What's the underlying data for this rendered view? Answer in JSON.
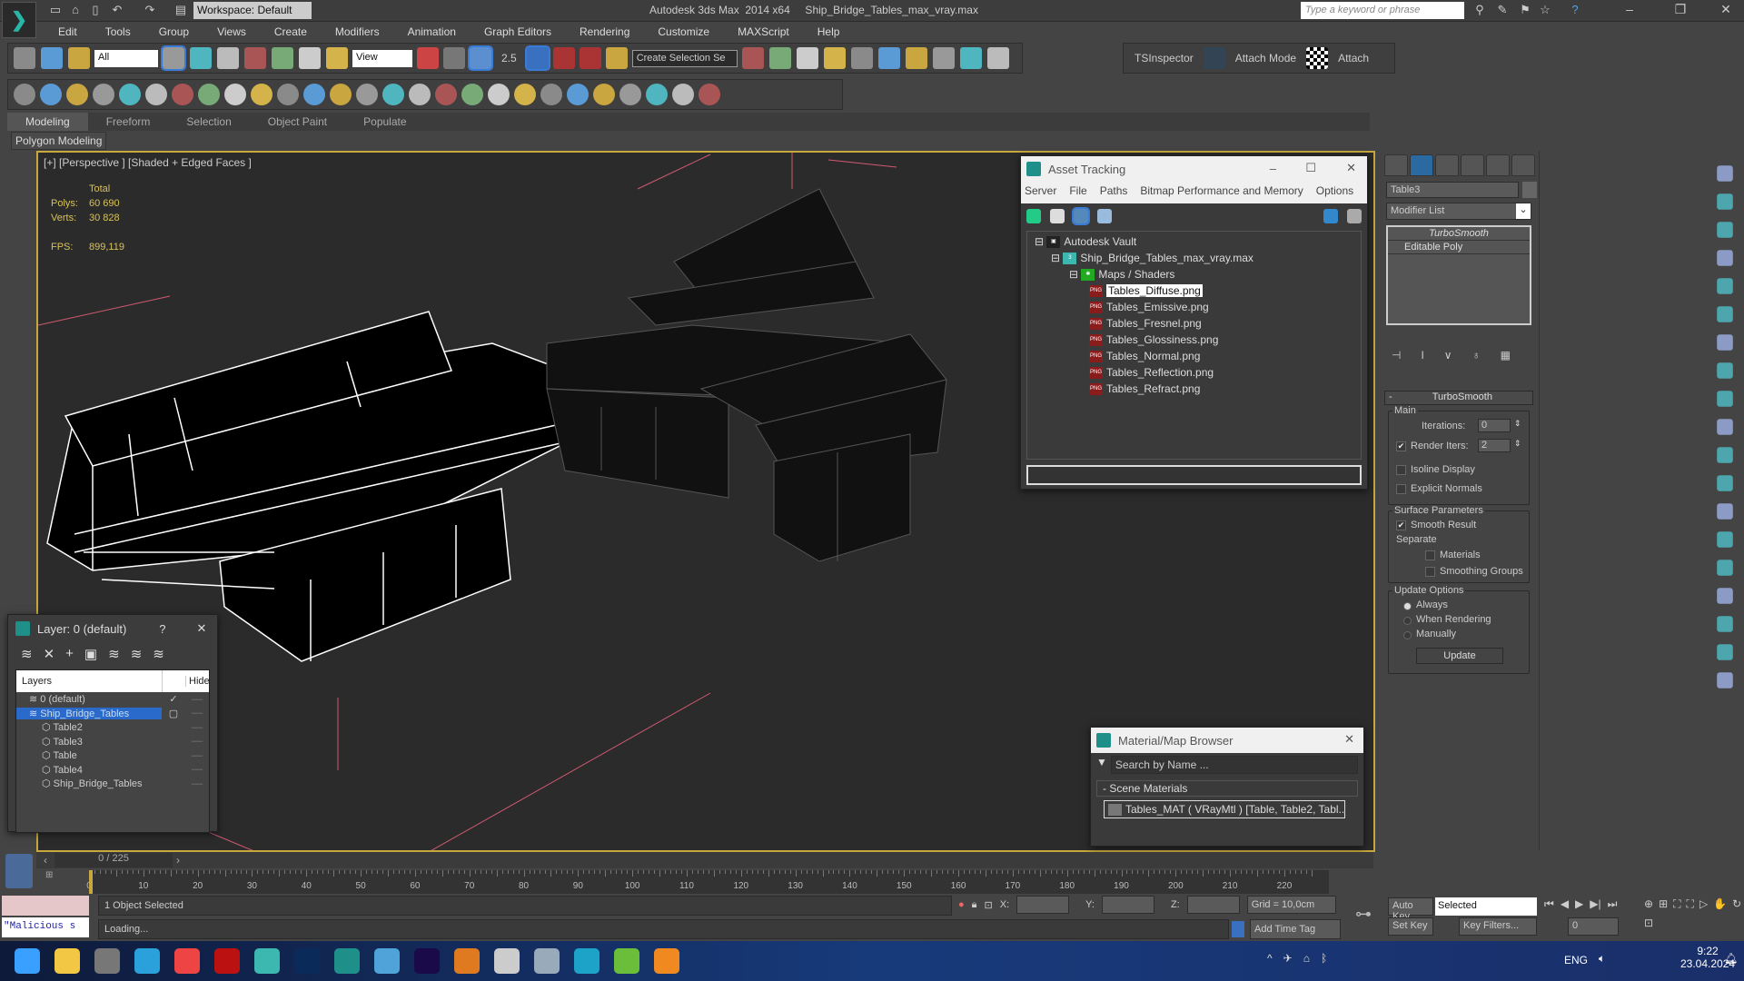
{
  "app": {
    "logo": "3ds-max-logo",
    "workspace": "Workspace: Default",
    "title": "Autodesk 3ds Max  2014 x64     Ship_Bridge_Tables_max_vray.max",
    "search_placeholder": "Type a keyword or phrase"
  },
  "menu": [
    "Edit",
    "Tools",
    "Group",
    "Views",
    "Create",
    "Modifiers",
    "Animation",
    "Graph Editors",
    "Rendering",
    "Customize",
    "MAXScript",
    "Help"
  ],
  "main_toolbar": {
    "selection_filter": "All",
    "ref_coord": "View",
    "snap_value": "2.5",
    "named_selection": "Create Selection Se",
    "tsinspector": "TSInspector",
    "attach_mode": "Attach Mode",
    "attach": "Attach",
    "icons": [
      "link-icon",
      "unlink-icon",
      "bind-space-warp-icon"
    ],
    "icons2": [
      "select-object-icon",
      "select-by-name-icon",
      "rect-region-icon",
      "window-crossing-icon",
      "move-icon",
      "rotate-icon",
      "scale-icon"
    ],
    "icons3": [
      "mirror-icon",
      "align-icon",
      "layer-manager-icon",
      "scene-explorer-icon",
      "curve-editor-icon",
      "schematic-icon",
      "material-editor-icon",
      "render-setup-icon",
      "render-frame-icon",
      "render-icon"
    ]
  },
  "second_toolbar": {
    "icons": [
      "teapot-icon",
      "box-icon",
      "list-icon",
      "grid-icon",
      "light-icon",
      "camera-icon",
      "helper-icon",
      "render-icon",
      "plane-icon",
      "dome-icon",
      "sphere-light-icon",
      "teapot2-icon",
      "cone-icon",
      "sun-icon",
      "sphere-icon",
      "particles-icon",
      "molecule-icon",
      "tower-icon",
      "flake-icon",
      "grass-icon",
      "hair-icon",
      "fur-icon",
      "ball-icon",
      "bitmap-icon",
      "material-icon",
      "info-icon",
      "help-icon"
    ]
  },
  "ribbon": {
    "tabs": [
      "Modeling",
      "Freeform",
      "Selection",
      "Object Paint",
      "Populate"
    ],
    "active": "Modeling",
    "panel": "Polygon Modeling"
  },
  "viewport": {
    "label": "[+] [Perspective ] [Shaded + Edged Faces ]",
    "stats": {
      "header": "Total",
      "polys_label": "Polys:",
      "polys": "60 690",
      "verts_label": "Verts:",
      "verts": "30 828",
      "fps_label": "FPS:",
      "fps": "899,119"
    }
  },
  "asset_tracking": {
    "title": "Asset Tracking",
    "menu": [
      "Server",
      "File",
      "Paths",
      "Bitmap Performance and Memory",
      "Options"
    ],
    "root": "Autodesk Vault",
    "file": "Ship_Bridge_Tables_max_vray.max",
    "folder": "Maps / Shaders",
    "maps": [
      "Tables_Diffuse.png",
      "Tables_Emissive.png",
      "Tables_Fresnel.png",
      "Tables_Glossiness.png",
      "Tables_Normal.png",
      "Tables_Reflection.png",
      "Tables_Refract.png"
    ],
    "selected": "Tables_Diffuse.png",
    "png_badge": "PNG"
  },
  "layer_dialog": {
    "title": "Layer: 0 (default)",
    "help": "?",
    "col_layers": "Layers",
    "col_hide": "Hide",
    "layers": [
      {
        "name": "0 (default)",
        "level": 0,
        "current": true
      },
      {
        "name": "Ship_Bridge_Tables",
        "level": 0,
        "selected": true
      },
      {
        "name": "Table2",
        "level": 1
      },
      {
        "name": "Table3",
        "level": 1
      },
      {
        "name": "Table",
        "level": 1
      },
      {
        "name": "Table4",
        "level": 1
      },
      {
        "name": "Ship_Bridge_Tables",
        "level": 1
      }
    ]
  },
  "material_browser": {
    "title": "Material/Map Browser",
    "search_placeholder": "Search by Name ...",
    "group": "- Scene Materials",
    "item": "Tables_MAT  ( VRayMtl )  [Table, Table2, Tabl..."
  },
  "command_panel": {
    "object_name": "Table3",
    "modifier_list": "Modifier List",
    "stack": [
      "TurboSmooth",
      "Editable Poly"
    ],
    "rollout": "TurboSmooth",
    "main": "Main",
    "iterations_label": "Iterations:",
    "iterations": "0",
    "render_iters_label": "Render Iters:",
    "render_iters": "2",
    "render_iters_checked": true,
    "isoline": "Isoline Display",
    "explicit": "Explicit Normals",
    "surface": "Surface Parameters",
    "smooth_result": "Smooth Result",
    "separate": "Separate",
    "materials": "Materials",
    "smoothing_groups": "Smoothing Groups",
    "update_options": "Update Options",
    "always": "Always",
    "when_rendering": "When Rendering",
    "manually": "Manually",
    "update": "Update"
  },
  "timeline": {
    "frame": "0 / 225",
    "ticks": [
      0,
      10,
      20,
      30,
      40,
      50,
      60,
      70,
      80,
      90,
      100,
      110,
      120,
      130,
      140,
      150,
      160,
      170,
      180,
      190,
      200,
      210,
      220
    ],
    "current": 0,
    "total": 225
  },
  "status": {
    "script_listener": "\"Malicious s",
    "selected": "1 Object Selected",
    "prompt": "Loading...",
    "x_label": "X:",
    "y_label": "Y:",
    "z_label": "Z:",
    "grid": "Grid = 10,0cm",
    "add_time_tag": "Add Time Tag",
    "auto_key": "Auto Key",
    "key_mode": "Selected",
    "set_key": "Set Key",
    "key_filters": "Key Filters...",
    "frame_field": "0"
  },
  "taskbar": {
    "lang": "ENG",
    "time": "9:22",
    "date": "23.04.2024",
    "apps": [
      {
        "name": "start",
        "color": "#3aa0ff"
      },
      {
        "name": "explorer",
        "color": "#f2c744"
      },
      {
        "name": "task-view",
        "color": "#777"
      },
      {
        "name": "telegram",
        "color": "#2aa1da"
      },
      {
        "name": "chrome",
        "color": "#e44"
      },
      {
        "name": "aida64",
        "color": "#b11"
      },
      {
        "name": "3ds-max-2",
        "color": "#3cb8b0"
      },
      {
        "name": "photoshop",
        "color": "#0a2a5a"
      },
      {
        "name": "3ds-max",
        "color": "#1f8f8a"
      },
      {
        "name": "notepad",
        "color": "#4fa3d8"
      },
      {
        "name": "after-effects",
        "color": "#1a0a4a"
      },
      {
        "name": "app-g",
        "color": "#e07a20"
      },
      {
        "name": "app-ring",
        "color": "#ccc"
      },
      {
        "name": "app-save",
        "color": "#9ab"
      },
      {
        "name": "edge",
        "color": "#1da2c8"
      },
      {
        "name": "torrent",
        "color": "#6abe3a"
      },
      {
        "name": "app-n",
        "color": "#f08a20"
      }
    ]
  }
}
